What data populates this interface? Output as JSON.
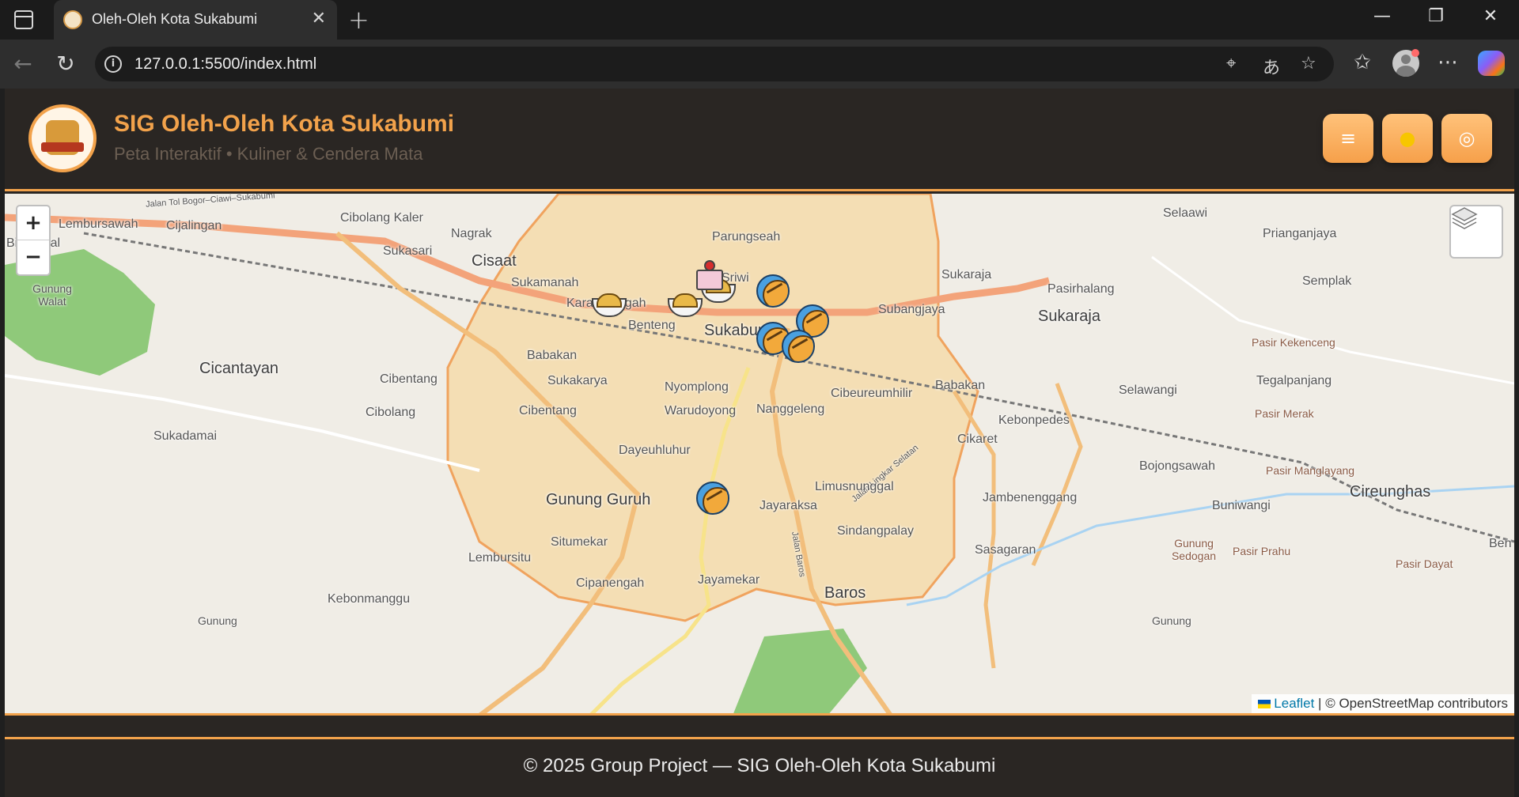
{
  "browser": {
    "tab_title": "Oleh-Oleh Kota Sukabumi",
    "url": "127.0.0.1:5500/index.html"
  },
  "header": {
    "title": "SIG Oleh-Oleh Kota Sukabumi",
    "subtitle": "Peta Interaktif • Kuliner & Cendera Mata",
    "buttons": [
      {
        "icon": "menu-icon",
        "glyph": "≡"
      },
      {
        "icon": "sun-icon",
        "glyph": "●"
      },
      {
        "icon": "locate-icon",
        "glyph": "◎"
      }
    ]
  },
  "map": {
    "zoom_in": "+",
    "zoom_out": "−",
    "attribution_link": "Leaflet",
    "attribution_text": " | © OpenStreetMap contributors",
    "place_labels": [
      "Jalan Tol Bogor–Ciawi–Sukabumi",
      "Lembursawah",
      "Cijalingan",
      "Cibolang Kaler",
      "Nagrak",
      "Sukasari",
      "Cisaat",
      "Sukamanah",
      "Gunung Walat",
      "Parungseah",
      "Sriwi",
      "Karangtengah",
      "Benteng",
      "Sukabumi",
      "Subangjaya",
      "Sukaraja",
      "Pasirhalang",
      "Sukaraja",
      "Selaawi",
      "Prianganjaya",
      "Semplak",
      "Pasir Kekenceng",
      "Tegalpanjang",
      "Selawangi",
      "Pasir Merak",
      "Babakan",
      "Sukakarya",
      "Nyomplong",
      "Cibeureumhilir",
      "Babakan",
      "Cicantayan",
      "Cibentang",
      "Cibolang",
      "Cibentang",
      "Warudoyong",
      "Nanggeleng",
      "Kebonpedes",
      "Cikaret",
      "Sukadamai",
      "Dayeuhluhur",
      "Bojongsawah",
      "Pasir Manglayang",
      "Cireunghas",
      "Jalan Lingkar Selatan",
      "Gunung Guruh",
      "Limusnunggal",
      "Jambenenggang",
      "Jayaraksa",
      "Buniwangi",
      "Situmekar",
      "Sindangpalay",
      "Gunung Sedogan",
      "Pasir Prahu",
      "Lembursitu",
      "Sasagaran",
      "Pasir Dayat",
      "Cipanengah",
      "Jayamekar",
      "Jalan Baros",
      "Baros",
      "Kebonmanggu",
      "Gunung",
      "Gunung",
      "Ben",
      "Bi",
      "unggal"
    ],
    "markers": [
      {
        "type": "food-marker"
      },
      {
        "type": "food-marker"
      },
      {
        "type": "food-marker"
      },
      {
        "type": "cake-marker"
      },
      {
        "type": "fruit-marker"
      },
      {
        "type": "fruit-marker"
      },
      {
        "type": "fruit-marker"
      },
      {
        "type": "fruit-marker"
      },
      {
        "type": "fruit-marker"
      },
      {
        "type": "fruit-marker"
      }
    ]
  },
  "footer": {
    "text": "© 2025 Group Project — SIG Oleh-Oleh Kota Sukabumi"
  },
  "colors": {
    "accent": "#f2a24b",
    "header_bg": "#2a2623",
    "city_area": "#f5d9a8",
    "road_major": "#f3a37a",
    "park": "#8fc97a"
  }
}
